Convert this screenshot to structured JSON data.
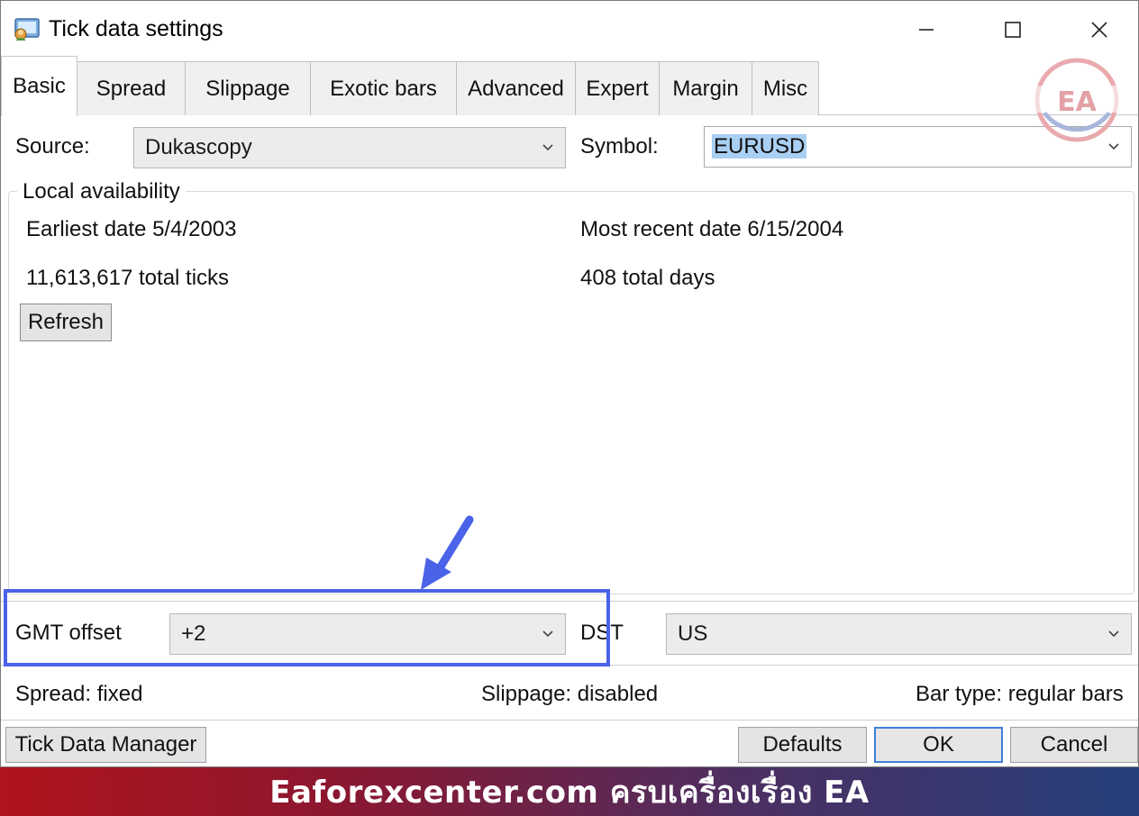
{
  "window": {
    "title": "Tick data settings"
  },
  "tabs": [
    {
      "label": "Basic",
      "active": true
    },
    {
      "label": "Spread",
      "active": false
    },
    {
      "label": "Slippage",
      "active": false
    },
    {
      "label": "Exotic bars",
      "active": false
    },
    {
      "label": "Advanced",
      "active": false
    },
    {
      "label": "Expert",
      "active": false
    },
    {
      "label": "Margin",
      "active": false
    },
    {
      "label": "Misc",
      "active": false
    }
  ],
  "basic": {
    "source_label": "Source:",
    "source_value": "Dukascopy",
    "symbol_label": "Symbol:",
    "symbol_value": "EURUSD",
    "local_availability": {
      "title": "Local availability",
      "earliest": "Earliest date 5/4/2003",
      "most_recent": "Most recent date 6/15/2004",
      "total_ticks": "11,613,617 total ticks",
      "total_days": "408 total days",
      "refresh_label": "Refresh"
    },
    "gmt_offset_label": "GMT offset",
    "gmt_offset_value": "+2",
    "dst_label": "DST",
    "dst_value": "US"
  },
  "status": {
    "spread_label": "Spread:",
    "spread_value": "fixed",
    "slippage_label": "Slippage:",
    "slippage_value": "disabled",
    "bartype_label": "Bar type:",
    "bartype_value": "regular bars"
  },
  "buttons": {
    "tick_data_manager": "Tick Data Manager",
    "defaults": "Defaults",
    "ok": "OK",
    "cancel": "Cancel"
  },
  "watermark": {
    "logo_text": "EA"
  },
  "banner": {
    "text": "Eaforexcenter.com ครบเครื่องเรื่อง EA"
  },
  "colors": {
    "highlight": "#4a63e8",
    "selection": "#a9cff2",
    "primary_button_border": "#3f7fd9"
  }
}
